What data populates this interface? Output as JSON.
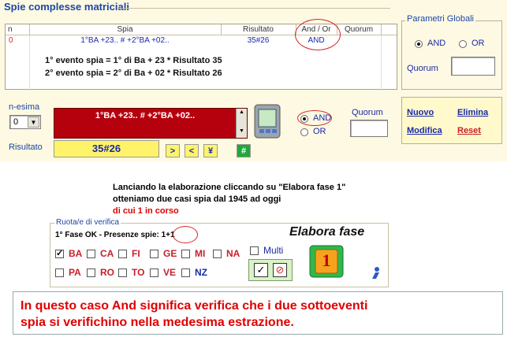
{
  "panel": {
    "title": "Spie complesse matriciali"
  },
  "grid": {
    "headers": [
      "n",
      "Spia",
      "Risultato",
      "And / Or",
      "Quorum"
    ],
    "row": {
      "n": "0",
      "spia": "1°BA +23.. # +2°BA +02..",
      "risultato": "35#26",
      "andor": "AND",
      "quorum": ""
    },
    "desc1": "1° evento spia = 1° di Ba + 23 * Risultato 35",
    "desc2": "2° evento spia = 2° di Ba + 02 * Risultato 26"
  },
  "params": {
    "legend": "Parametri Globali",
    "and": "AND",
    "or": "OR",
    "quorum_label": "Quorum"
  },
  "editor": {
    "nesima_label": "n-esima",
    "nesima_value": "0",
    "spia_text": "1°BA +23.. # +2°BA +02..",
    "risultato_label": "Risultato",
    "risultato_value": "35#26",
    "btn_gt": ">",
    "btn_lt": "<",
    "btn_yen": "¥",
    "btn_hash": "#",
    "and": "AND",
    "or": "OR",
    "quorum_label": "Quorum"
  },
  "actions": {
    "nuovo": "Nuovo",
    "elimina": "Elimina",
    "modifica": "Modifica",
    "reset": "Reset"
  },
  "note": {
    "line1": "Lanciando la elaborazione cliccando su \"Elabora fase 1\"",
    "line2": "otteniamo due casi spia dal 1945 ad oggi",
    "line3": "di cui 1 in corso"
  },
  "ruota": {
    "legend": "Ruota/e di verifica",
    "fase": "1° Fase OK - Presenze spie: 1+1",
    "elabora": "Elabora fase",
    "multi": "Multi",
    "badge": "1",
    "row1": [
      "BA",
      "CA",
      "FI",
      "GE",
      "MI",
      "NA"
    ],
    "row2": [
      "PA",
      "RO",
      "TO",
      "VE",
      "NZ"
    ],
    "checked": "BA"
  },
  "footer": {
    "line1": "In questo caso And significa verifica che i due  sottoeventi",
    "line2": "spia si verifichino nella medesima estrazione."
  },
  "colors": {
    "accent": "#1a47a8",
    "red": "#b5000e",
    "yellow": "#fff36a",
    "note_red": "#e00000"
  }
}
